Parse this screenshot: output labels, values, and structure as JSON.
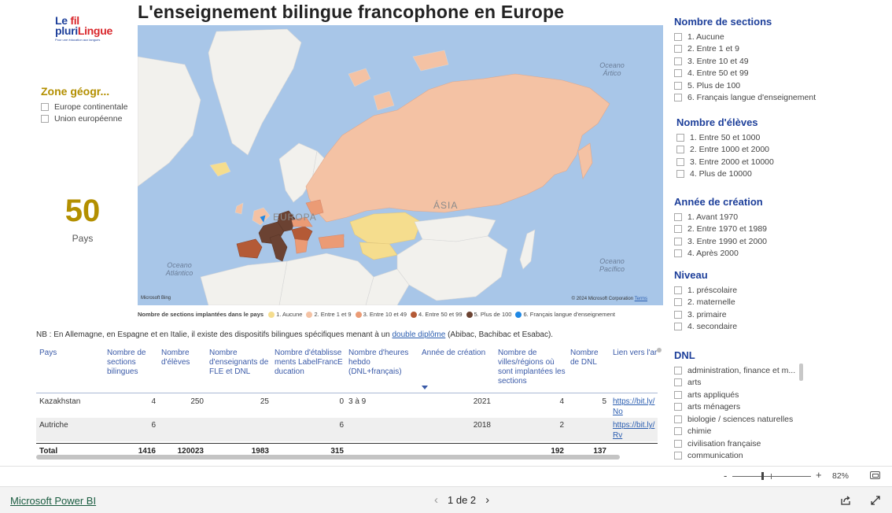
{
  "title": "L'enseignement bilingue francophone en Europe",
  "logo": {
    "line1a": "Le ",
    "line1b": "fil",
    "line2a": "pluri",
    "line2b": "Lingue",
    "tagline": "Pour une éducation aux langues"
  },
  "zone_filter": {
    "title": "Zone géogr...",
    "options": [
      "Europe continentale",
      "Union européenne"
    ]
  },
  "kpi": {
    "value": "50",
    "label": "Pays"
  },
  "map": {
    "labels": {
      "arctic": "Oceano\nÁrtico",
      "atlantic": "Oceano\nAtlántico",
      "pacific": "Oceano\nPacífico",
      "europa": "EUROPA",
      "asia": "ÁSIA"
    },
    "bing": "Microsoft Bing",
    "copyright": "© 2024 Microsoft Corporation",
    "terms": "Terms",
    "colors": {
      "water": "#a8c6e8",
      "land": "#f2f1ed",
      "aucune": "#f5dd8e",
      "entre1et9": "#f4c2a4",
      "entre10et49": "#eb9b75",
      "entre50et99": "#b45a36",
      "plus100": "#6b4232",
      "francais": "#1e88e5"
    }
  },
  "legend": {
    "title": "Nombre de sections implantées dans le pays",
    "items": [
      {
        "label": "1. Aucune",
        "color": "#f5dd8e"
      },
      {
        "label": "2. Entre 1 et 9",
        "color": "#f4c2a4"
      },
      {
        "label": "3. Entre 10 et 49",
        "color": "#eb9b75"
      },
      {
        "label": "4. Entre 50 et 99",
        "color": "#b45a36"
      },
      {
        "label": "5. Plus de 100",
        "color": "#6b4232"
      },
      {
        "label": "6. Français langue d'enseignement",
        "color": "#1e88e5"
      }
    ]
  },
  "note": {
    "before": "NB : En Allemagne, en Espagne et en Italie, il existe des dispositifs bilingues spécifiques menant à un ",
    "link": "double diplôme",
    "after": " (Abibac, Bachibac et Esabac)."
  },
  "table": {
    "headers": [
      "Pays",
      "Nombre de sections bilingues",
      "Nombre d'élèves",
      "Nombre d'enseignants de FLE et DNL",
      "Nombre d'établissements LabelFrancEducation",
      "Nombre d'heures hebdo (DNL+français)",
      "Année de création",
      "Nombre de villes/régions où sont implantées les sections",
      "Nombre de DNL",
      "Lien vers l'article Fil pluriLingue"
    ],
    "rows": [
      {
        "pays": "Kazakhstan",
        "sections": "4",
        "eleves": "250",
        "enseignants": "25",
        "etabl": "0",
        "heures": "3 à 9",
        "annee": "2021",
        "villes": "4",
        "dnl": "5",
        "lien": "https://bit.ly/",
        "lien2": "No"
      },
      {
        "pays": "Autriche",
        "sections": "6",
        "eleves": "",
        "enseignants": "",
        "etabl": "6",
        "heures": "",
        "annee": "2018",
        "villes": "2",
        "dnl": "",
        "lien": "https://bit.ly/",
        "lien2": "Rv"
      }
    ],
    "total": {
      "label": "Total",
      "sections": "1416",
      "eleves": "120023",
      "enseignants": "1983",
      "etabl": "315",
      "villes": "192",
      "dnl": "137"
    }
  },
  "filters": {
    "sections": {
      "title": "Nombre de sections",
      "options": [
        "1. Aucune",
        "2. Entre 1 et 9",
        "3. Entre 10 et 49",
        "4. Entre 50 et 99",
        "5. Plus de 100",
        "6. Français langue d'enseignement"
      ]
    },
    "eleves": {
      "title": "Nombre d'élèves",
      "options": [
        "1. Entre 50 et 1000",
        "2. Entre 1000 et 2000",
        "3. Entre 2000 et 10000",
        "4. Plus de 10000"
      ]
    },
    "annee": {
      "title": "Année de création",
      "options": [
        "1. Avant 1970",
        "2. Entre 1970 et 1989",
        "3. Entre 1990 et 2000",
        "4. Après 2000"
      ]
    },
    "niveau": {
      "title": "Niveau",
      "options": [
        "1. préscolaire",
        "2. maternelle",
        "3. primaire",
        "4. secondaire"
      ]
    },
    "dnl": {
      "title": "DNL",
      "options": [
        "administration, finance et m...",
        "arts",
        "arts appliqués",
        "arts ménagers",
        "biologie / sciences naturelles",
        "chimie",
        "civilisation française",
        "communication"
      ]
    }
  },
  "zoom": {
    "minus": "-",
    "plus": "+",
    "percent": "82%"
  },
  "footer": {
    "brand": "Microsoft Power BI",
    "page": "1 de 2",
    "prev": "‹",
    "next": "›"
  }
}
